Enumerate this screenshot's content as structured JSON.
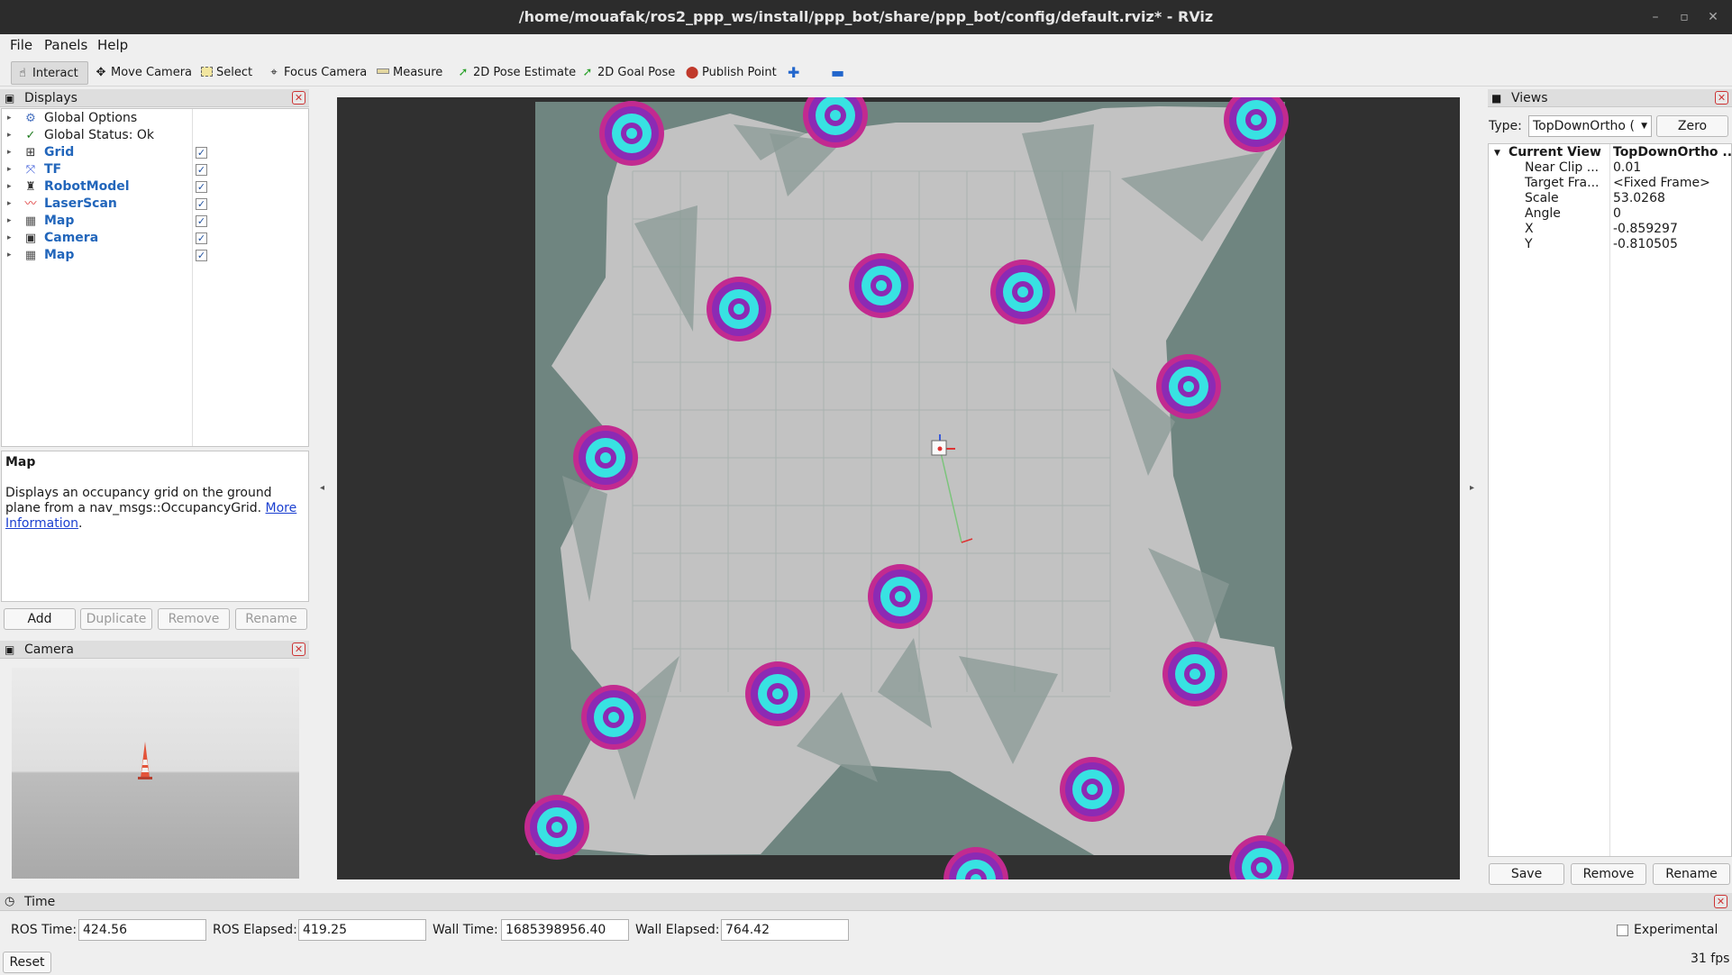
{
  "window": {
    "title": "/home/mouafak/ros2_ppp_ws/install/ppp_bot/share/ppp_bot/config/default.rviz* - RViz"
  },
  "menu": [
    "File",
    "Panels",
    "Help"
  ],
  "toolbar": {
    "interact": "Interact",
    "move_camera": "Move Camera",
    "select": "Select",
    "focus_camera": "Focus Camera",
    "measure": "Measure",
    "pose_estimate": "2D Pose Estimate",
    "goal_pose": "2D Goal Pose",
    "publish_point": "Publish Point"
  },
  "displays": {
    "title": "Displays",
    "items": [
      {
        "label": "Global Options",
        "icon": "gear-icon",
        "checked": null
      },
      {
        "label": "Global Status: Ok",
        "icon": "check-icon",
        "checked": null
      },
      {
        "label": "Grid",
        "icon": "grid-icon",
        "checked": true
      },
      {
        "label": "TF",
        "icon": "tf-icon",
        "checked": true
      },
      {
        "label": "RobotModel",
        "icon": "robot-icon",
        "checked": true
      },
      {
        "label": "LaserScan",
        "icon": "laserscan-icon",
        "checked": true
      },
      {
        "label": "Map",
        "icon": "map-icon",
        "checked": true
      },
      {
        "label": "Camera",
        "icon": "camera-icon",
        "checked": true
      },
      {
        "label": "Map",
        "icon": "map-icon",
        "checked": true
      }
    ],
    "desc_title": "Map",
    "desc_text": "Displays an occupancy grid on the ground plane from a nav_msgs::OccupancyGrid.",
    "desc_link1": "More",
    "desc_link2": "Information",
    "desc_end": ".",
    "buttons": {
      "add": "Add",
      "duplicate": "Duplicate",
      "remove": "Remove",
      "rename": "Rename"
    }
  },
  "camera": {
    "title": "Camera"
  },
  "views": {
    "title": "Views",
    "type_label": "Type:",
    "type_value": "TopDownOrtho (",
    "zero": "Zero",
    "props": [
      {
        "name": "Current View",
        "value": "TopDownOrtho ..."
      },
      {
        "name": "Near Clip ...",
        "value": "0.01"
      },
      {
        "name": "Target Fra...",
        "value": "<Fixed Frame>"
      },
      {
        "name": "Scale",
        "value": "53.0268"
      },
      {
        "name": "Angle",
        "value": "0"
      },
      {
        "name": "X",
        "value": "-0.859297"
      },
      {
        "name": "Y",
        "value": "-0.810505"
      }
    ],
    "buttons": {
      "save": "Save",
      "remove": "Remove",
      "rename": "Rename"
    }
  },
  "time": {
    "title": "Time",
    "ros_time_label": "ROS Time:",
    "ros_time": "424.56",
    "ros_elapsed_label": "ROS Elapsed:",
    "ros_elapsed": "419.25",
    "wall_time_label": "Wall Time:",
    "wall_time": "1685398956.40",
    "wall_elapsed_label": "Wall Elapsed:",
    "wall_elapsed": "764.42",
    "experimental": "Experimental",
    "reset": "Reset",
    "fps": "31 fps"
  },
  "colors": {
    "map_free": "#c2c2c2",
    "map_unknown": "#6f8580",
    "scan_cyan": "#38e2e2",
    "scan_purple": "#8c2ab4",
    "scan_magenta": "#c22a90"
  }
}
